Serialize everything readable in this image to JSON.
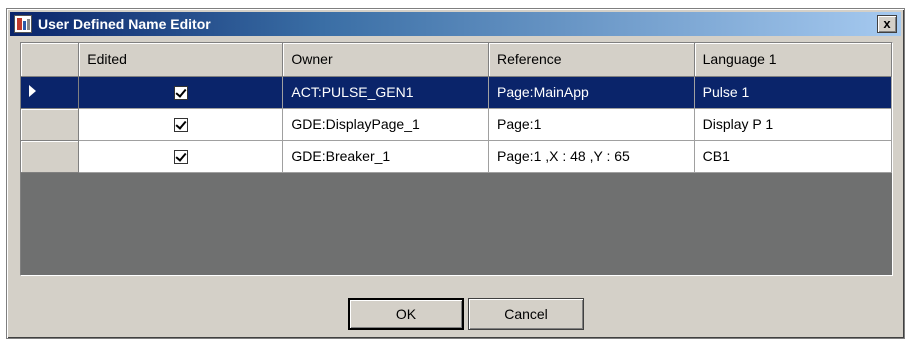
{
  "window": {
    "title": "User Defined Name Editor",
    "close_glyph": "x"
  },
  "grid": {
    "columns": [
      "Edited",
      "Owner",
      "Reference",
      "Language 1"
    ],
    "rows": [
      {
        "edited": true,
        "owner": "ACT:PULSE_GEN1",
        "reference": "Page:MainApp",
        "language1": "Pulse 1",
        "selected": true
      },
      {
        "edited": true,
        "owner": "GDE:DisplayPage_1",
        "reference": "Page:1",
        "language1": "Display P 1",
        "selected": false
      },
      {
        "edited": true,
        "owner": "GDE:Breaker_1",
        "reference": "Page:1 ,X : 48 ,Y : 65",
        "language1": "CB1",
        "selected": false
      }
    ]
  },
  "buttons": {
    "ok": "OK",
    "cancel": "Cancel"
  },
  "colors": {
    "selection": "#0a246a",
    "dialog_face": "#d4d0c8",
    "grid_empty": "#6f7070"
  }
}
